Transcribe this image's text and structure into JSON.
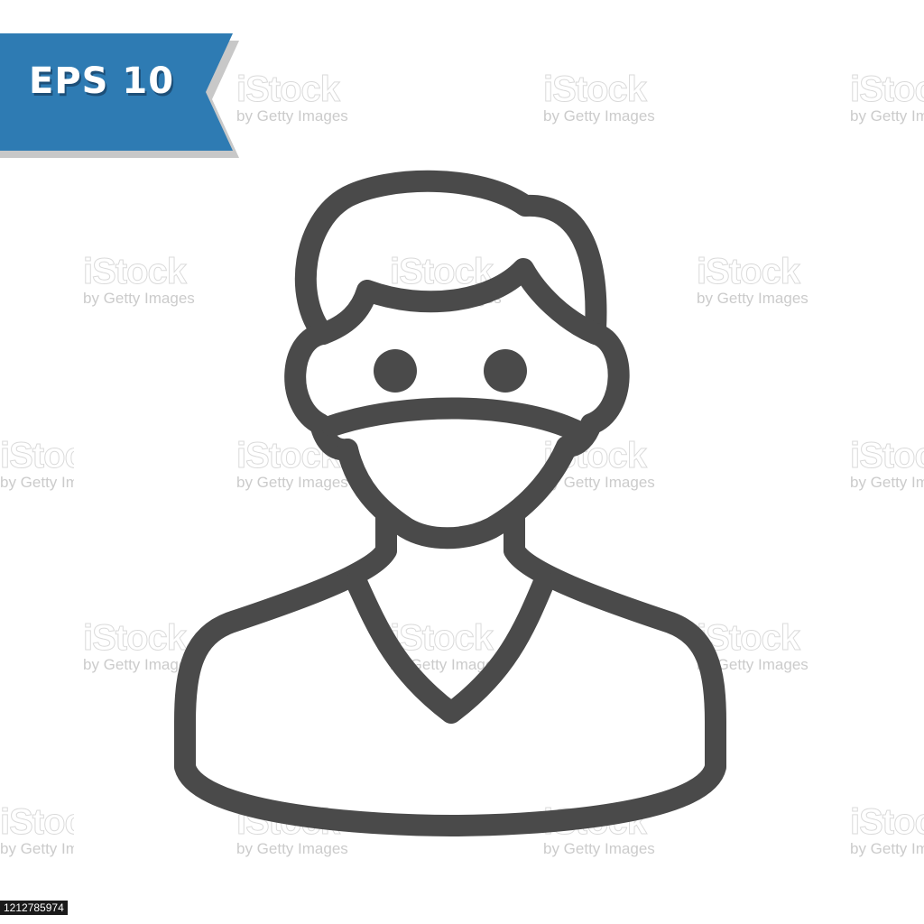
{
  "badge": {
    "label": "EPS 10",
    "color": "#2e7bb3",
    "shadow_color": "#c8c8c8"
  },
  "watermark": {
    "main": "iStock",
    "sub": "by Getty Images"
  },
  "image_id": "1212785974",
  "icon": {
    "name": "person-wearing-face-mask-icon",
    "stroke_color": "#4a4a4a"
  }
}
